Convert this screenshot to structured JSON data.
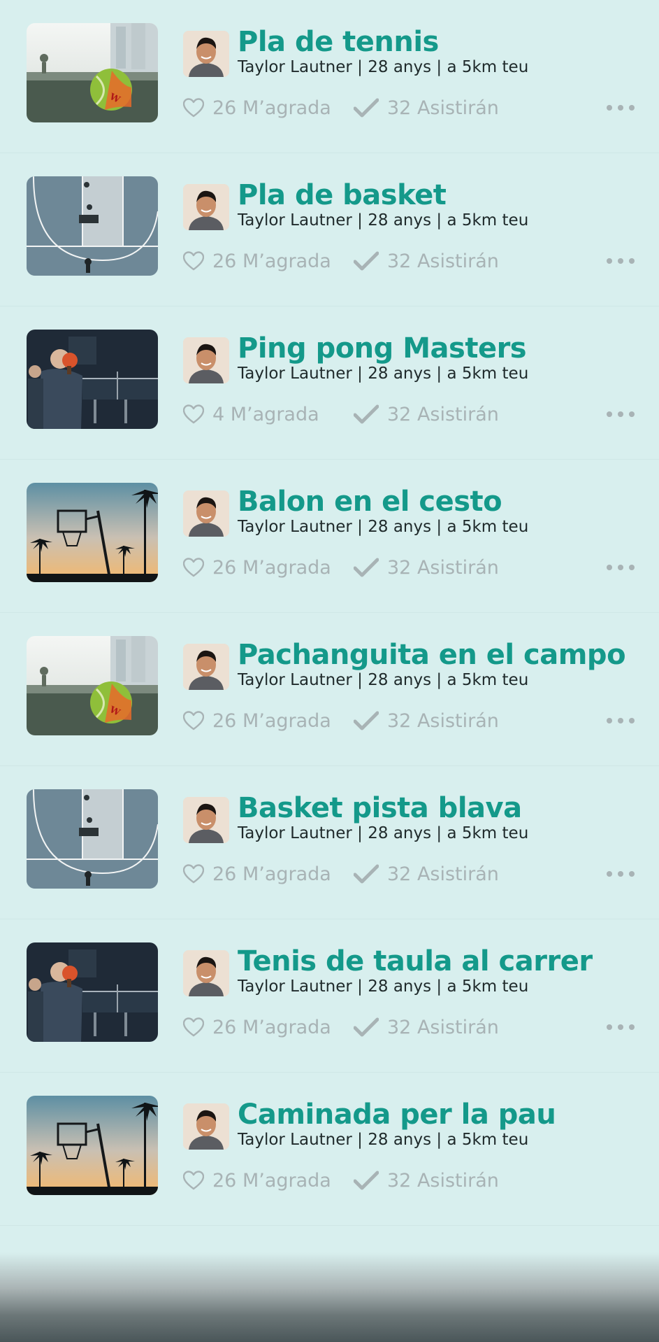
{
  "events": [
    {
      "title": "Pla de tennis",
      "subtitle": "Taylor Lautner | 28 anys | a 5km teu",
      "likes": "26 M’agrada",
      "attending": "32 Asistirán",
      "image": "tennis-ball"
    },
    {
      "title": "Pla de basket",
      "subtitle": "Taylor Lautner | 28 anys | a 5km teu",
      "likes": "26 M’agrada",
      "attending": "32 Asistirán",
      "image": "basketball-court"
    },
    {
      "title": "Ping pong Masters",
      "subtitle": "Taylor Lautner | 28 anys | a 5km teu",
      "likes": "4 M’agrada",
      "attending": "32 Asistirán",
      "image": "ping-pong"
    },
    {
      "title": "Balon en el cesto",
      "subtitle": "Taylor Lautner | 28 anys | a 5km teu",
      "likes": "26 M’agrada",
      "attending": "32 Asistirán",
      "image": "basketball-hoop-palms"
    },
    {
      "title": "Pachanguita en el campo",
      "subtitle": "Taylor Lautner | 28 anys | a 5km teu",
      "likes": "26 M’agrada",
      "attending": "32 Asistirán",
      "image": "tennis-ball"
    },
    {
      "title": "Basket pista blava",
      "subtitle": "Taylor Lautner | 28 anys | a 5km teu",
      "likes": "26 M’agrada",
      "attending": "32 Asistirán",
      "image": "basketball-court"
    },
    {
      "title": "Tenis de taula al carrer",
      "subtitle": "Taylor Lautner | 28 anys | a 5km teu",
      "likes": "26 M’agrada",
      "attending": "32 Asistirán",
      "image": "ping-pong"
    },
    {
      "title": "Caminada per la pau",
      "subtitle": "Taylor Lautner | 28 anys | a 5km teu",
      "likes": "26 M’agrada",
      "attending": "32 Asistirán",
      "image": "basketball-hoop-palms"
    }
  ],
  "icons": {
    "like": "heart-outline-icon",
    "attend": "checkmark-icon",
    "more": "more-dots-icon"
  },
  "colors": {
    "background": "#d8efee",
    "title": "#14998a",
    "subtitle": "#1f2a2b",
    "meta": "#a8b3b5"
  }
}
